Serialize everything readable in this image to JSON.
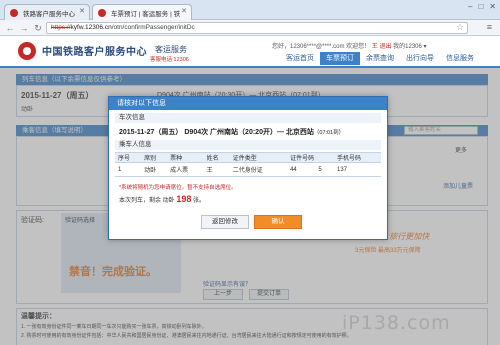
{
  "browser": {
    "tabs": [
      {
        "label": "铁路客户服务中心"
      },
      {
        "label": "车票预订 | 客运服务 | 铁"
      }
    ],
    "url_scheme": "https://",
    "url_host": "kyfw.12306.cn",
    "url_path": "/otn/confirmPassenger/initDc"
  },
  "site": {
    "title": "中国铁路客户服务中心",
    "subtitle": "客运服务",
    "hotline": "客服电话 12306",
    "welcome": "您好，12306****@****.com 欢迎您！",
    "user_short": "王",
    "exit": "退出",
    "account": "我的12306 ▾",
    "nav": [
      "客运首页",
      "车票预订",
      "余票查询",
      "出行向导",
      "信息服务"
    ],
    "active_nav": "车票预订"
  },
  "background": {
    "section1": "列车信息（以下余票信息仅供参考）",
    "date_line": "2015-11-27（周五）",
    "train_line": "D904次 广州南站（20:30开）— 北京西站（07:01到）",
    "seat_short": "动卧",
    "section2": "乘客信息（填写说明）",
    "search_placeholder": "输入乘客姓名",
    "more": "更多",
    "add_child": "添加儿童票",
    "verify_label": "验证码:",
    "verify_hint": "验证码选择",
    "verify_slogan": "禁音！完成验证。",
    "link_refresh": "验证码显示有误？",
    "btn_prev": "上一步",
    "btn_submit": "提交订单",
    "tips_title": "温馨提示：",
    "tips_lines": [
      "1. 一张有效身份证件同一乘车日期同一车次只能购买一张车票，高铁动卧列车除外。",
      "2. 购票时可使用的有效身份证件包括：中华人民共和国居民身份证、港澳居民来往内地通行证、台湾居民来往大陆通行证和按规定可使用的有效护照。"
    ],
    "promo_line1": "便利乘车 旅行更加快",
    "promo_line2": "3元保险  最高33万元保障"
  },
  "modal": {
    "title": "请核对以下信息",
    "train_section": "车次信息",
    "date": "2015-11-27（周五）",
    "train": "D904次 广州南站（20:20开）— 北京西站",
    "arrive": "（07:01到）",
    "pax_section": "乘车人信息",
    "columns": [
      "序号",
      "席别",
      "票种",
      "姓名",
      "证件类型",
      "证件号码",
      "手机号码"
    ],
    "rows": [
      [
        "1",
        "动卧",
        "成人票",
        "王",
        "二代身份证",
        "44",
        "5",
        "137"
      ]
    ],
    "note": "*系统将随机为您申请席位，暂不支持自选席位。",
    "ticket_prefix": "本次列车，剩余 动卧",
    "ticket_count": "198",
    "ticket_suffix": "张。",
    "btn_back": "返回修改",
    "btn_confirm": "确认"
  },
  "watermark": "iP138.com"
}
